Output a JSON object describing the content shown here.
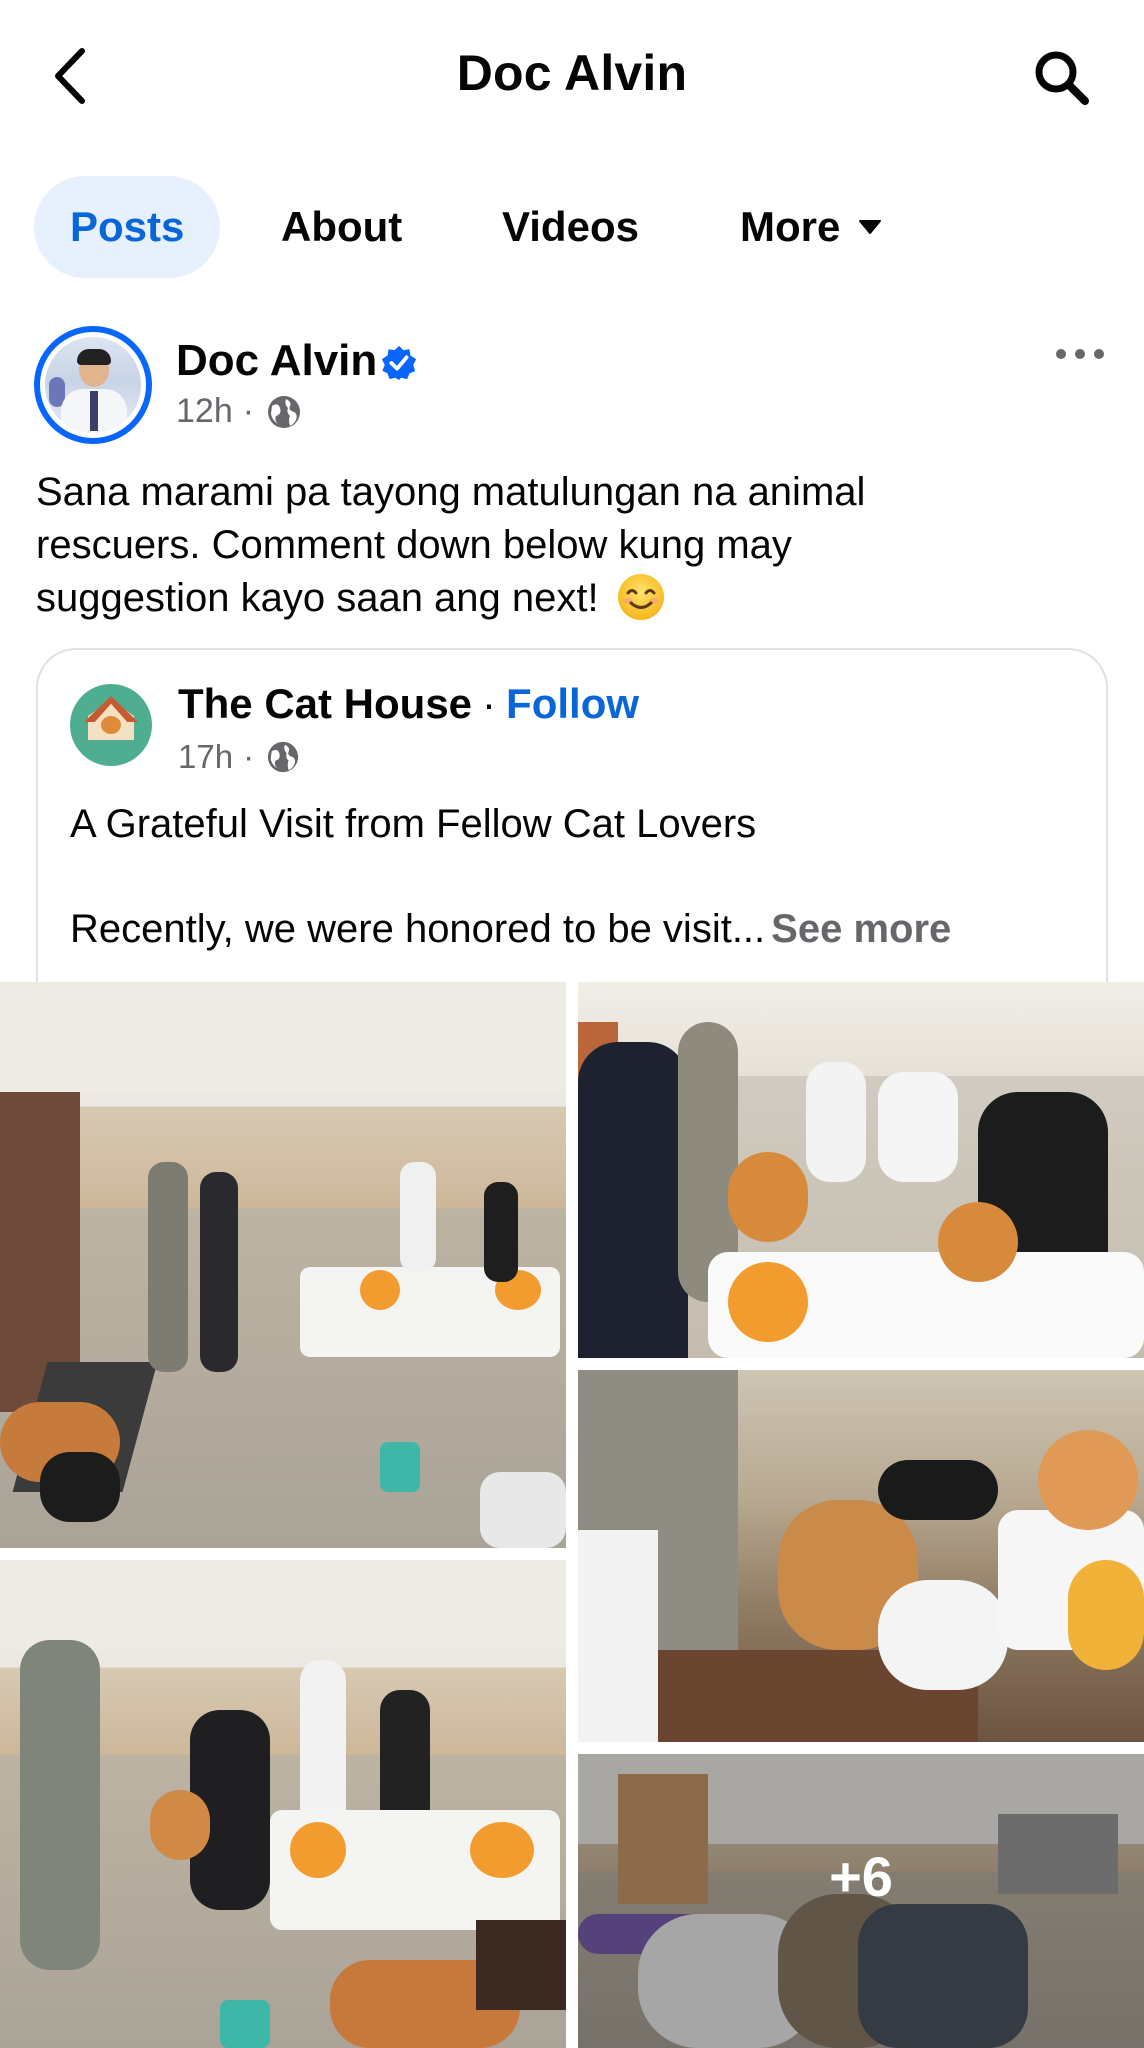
{
  "header": {
    "title": "Doc Alvin"
  },
  "tabs": [
    {
      "label": "Posts",
      "active": true
    },
    {
      "label": "About",
      "active": false
    },
    {
      "label": "Videos",
      "active": false
    },
    {
      "label": "More",
      "active": false
    }
  ],
  "post": {
    "author": "Doc Alvin",
    "time": "12h",
    "separator": "·",
    "text_lines": [
      "Sana marami pa tayong matulungan na animal",
      "rescuers. Comment down below kung may",
      "suggestion kayo saan ang next!"
    ],
    "emoji": "smiling-face-emoji"
  },
  "shared": {
    "page_name": "The Cat House",
    "separator": "·",
    "follow_label": "Follow",
    "time": "17h",
    "title": "A Grateful Visit from Fellow Cat Lovers",
    "body": "Recently, we were honored to be visit...",
    "see_more": "See more"
  },
  "photos": {
    "more_count": "+6"
  },
  "colors": {
    "accent": "#0866d8",
    "tab_active_bg": "#e7f0fd",
    "secondary_text": "#65676b",
    "verified": "#0866ff"
  },
  "icons": [
    "back-arrow-icon",
    "search-icon",
    "caret-down-icon",
    "verified-badge-icon",
    "globe-icon",
    "more-options-icon"
  ]
}
